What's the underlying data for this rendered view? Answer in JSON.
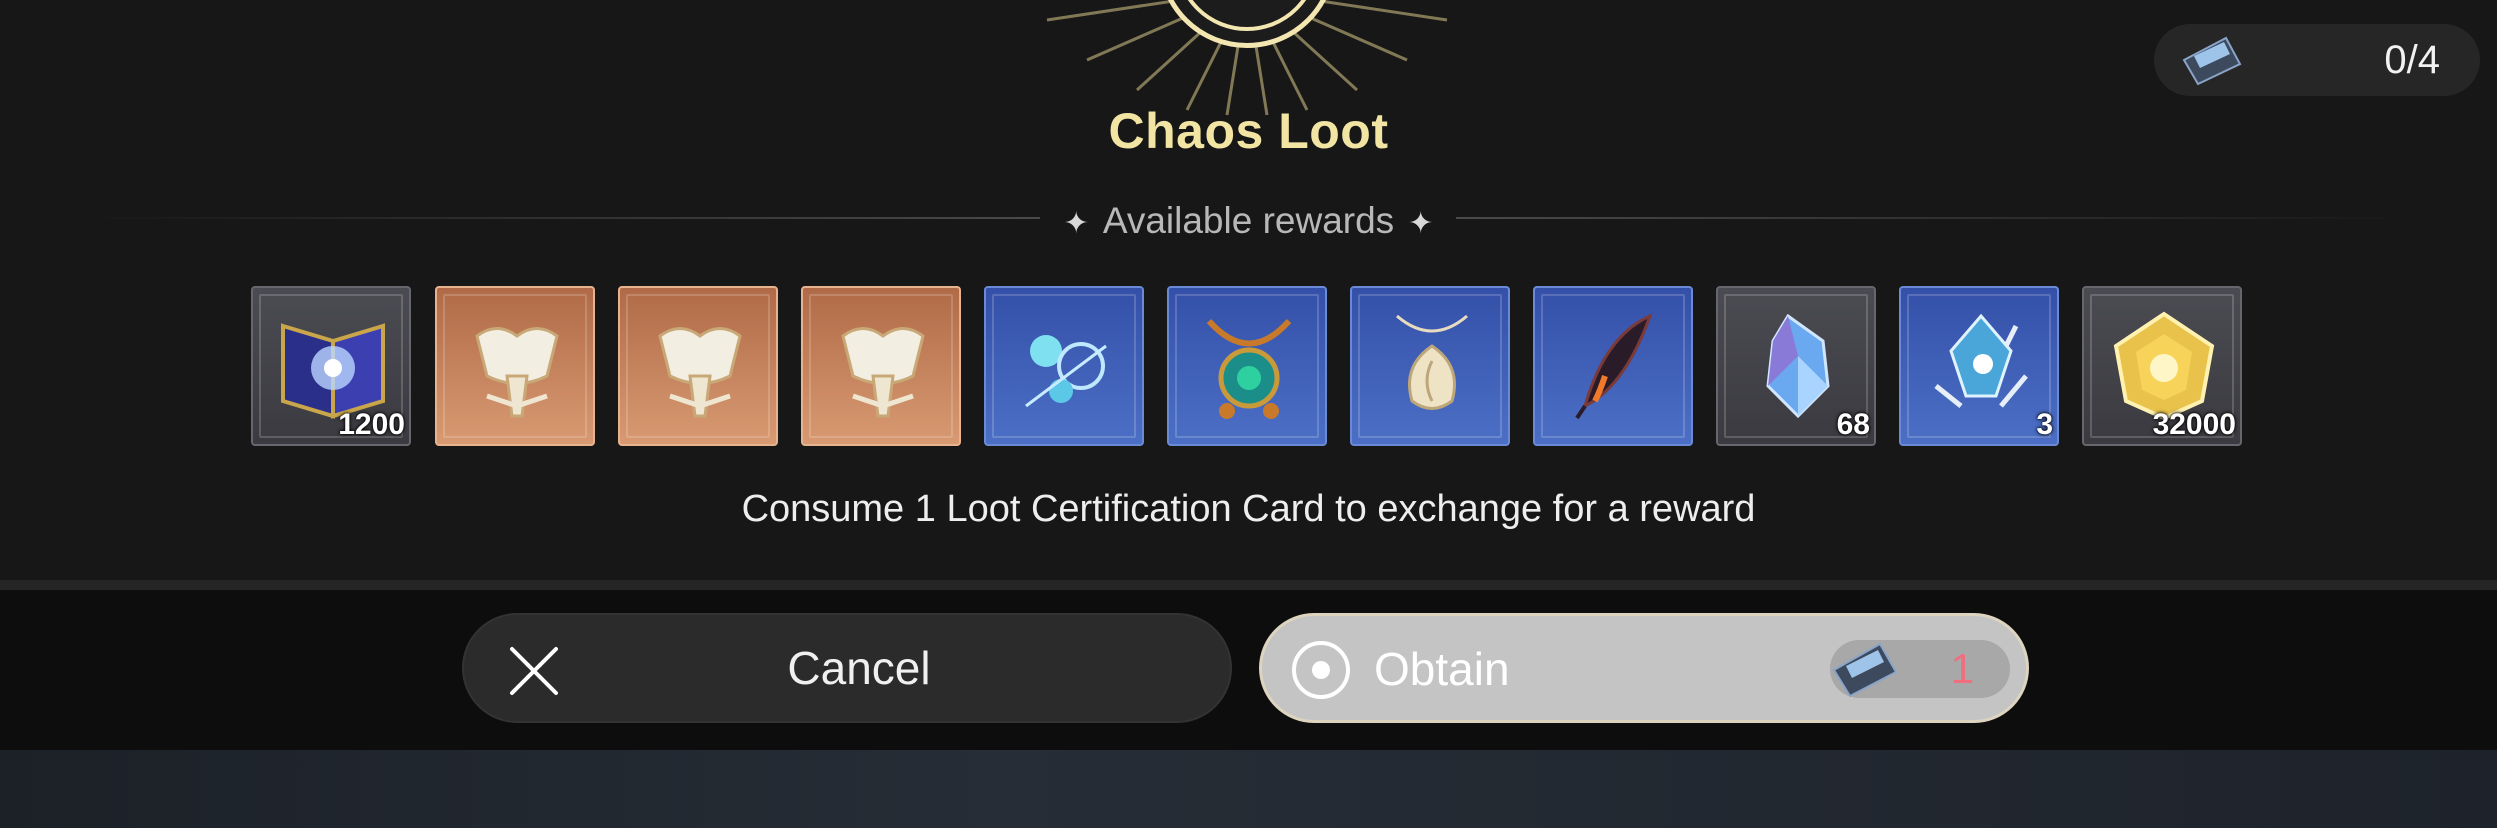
{
  "header": {
    "title": "Chaos Loot",
    "subtitle": "Available rewards",
    "counter": "0/4"
  },
  "rewards": [
    {
      "name": "starry-book",
      "rarity": "grey",
      "quantity": "1200"
    },
    {
      "name": "fragment-orange-1",
      "rarity": "orange",
      "quantity": ""
    },
    {
      "name": "fragment-orange-2",
      "rarity": "orange",
      "quantity": ""
    },
    {
      "name": "fragment-orange-3",
      "rarity": "orange",
      "quantity": ""
    },
    {
      "name": "flower-ornament",
      "rarity": "blue",
      "quantity": ""
    },
    {
      "name": "jade-necklace",
      "rarity": "blue",
      "quantity": ""
    },
    {
      "name": "shell-pendant",
      "rarity": "blue",
      "quantity": ""
    },
    {
      "name": "dark-feather",
      "rarity": "blue",
      "quantity": ""
    },
    {
      "name": "blue-crystal",
      "rarity": "grey",
      "quantity": "68"
    },
    {
      "name": "crystal-orb",
      "rarity": "blue",
      "quantity": "3"
    },
    {
      "name": "gold-coin",
      "rarity": "grey",
      "quantity": "32000"
    }
  ],
  "caption": "Consume 1 Loot Certification Card to exchange for a reward",
  "buttons": {
    "cancel_label": "Cancel",
    "obtain_label": "Obtain",
    "cost": "1"
  },
  "colors": {
    "title": "#f2e4a3",
    "cost": "#f06e7e"
  },
  "icons": {
    "cancel": "close-x-icon",
    "obtain": "target-circle-icon",
    "card": "loot-card-icon"
  }
}
